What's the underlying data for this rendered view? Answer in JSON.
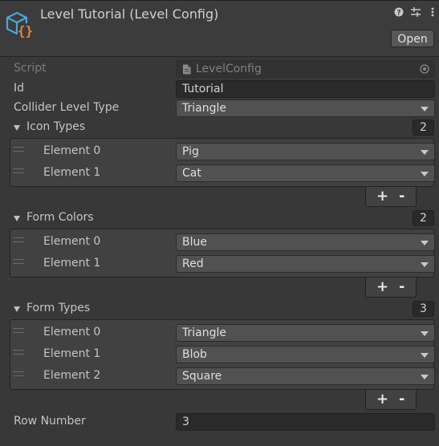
{
  "header": {
    "title": "Level Tutorial (Level Config)",
    "open_label": "Open",
    "icons": [
      "help-icon",
      "presets-icon",
      "more-menu-icon"
    ]
  },
  "fields": {
    "script": {
      "label": "Script",
      "value": "LevelConfig"
    },
    "id": {
      "label": "Id",
      "value": "Tutorial"
    },
    "collider_level_type": {
      "label": "Collider Level Type",
      "value": "Triangle"
    },
    "row_number": {
      "label": "Row Number",
      "value": "3"
    }
  },
  "lists": {
    "icon_types": {
      "label": "Icon Types",
      "count": "2",
      "items": [
        {
          "label": "Element 0",
          "value": "Pig"
        },
        {
          "label": "Element 1",
          "value": "Cat"
        }
      ]
    },
    "form_colors": {
      "label": "Form Colors",
      "count": "2",
      "items": [
        {
          "label": "Element 0",
          "value": "Blue"
        },
        {
          "label": "Element 1",
          "value": "Red"
        }
      ]
    },
    "form_types": {
      "label": "Form Types",
      "count": "3",
      "items": [
        {
          "label": "Element 0",
          "value": "Triangle"
        },
        {
          "label": "Element 1",
          "value": "Blob"
        },
        {
          "label": "Element 2",
          "value": "Square"
        }
      ]
    },
    "add_label": "+",
    "remove_label": "-"
  },
  "colors": {
    "background": "#383838",
    "logo_blue": "#4aa7d6",
    "logo_orange": "#e8823a"
  }
}
